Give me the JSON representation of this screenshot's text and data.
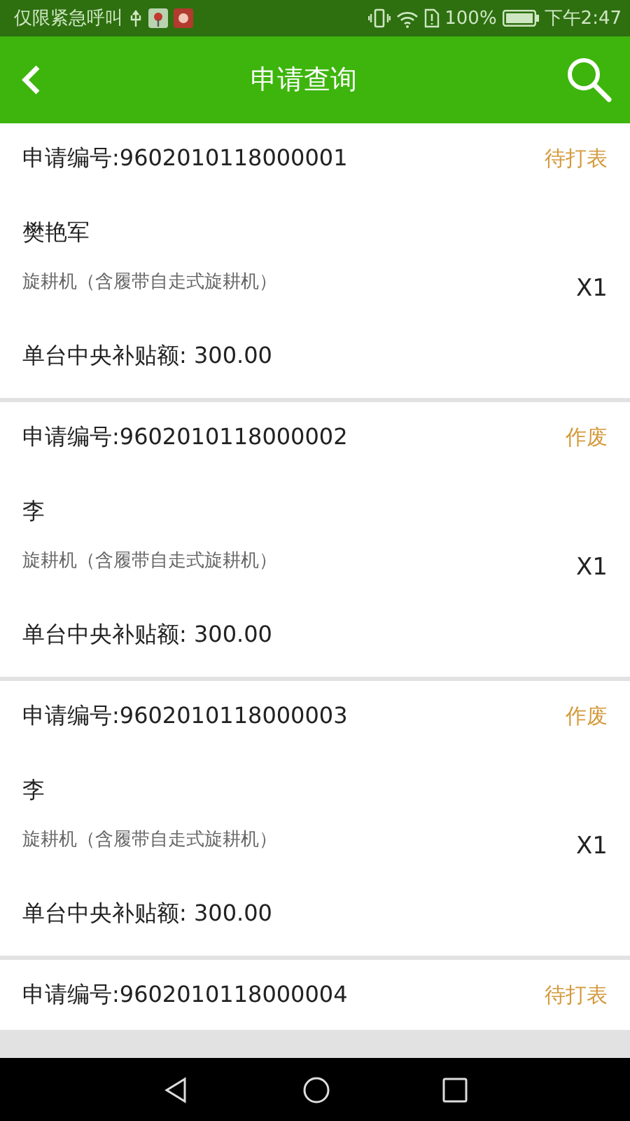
{
  "status_bar": {
    "carrier": "仅限紧急呼叫",
    "battery": "100%",
    "time": "下午2:47"
  },
  "header": {
    "title": "申请查询"
  },
  "records": [
    {
      "number": "申请编号:9602010118000001",
      "status": "待打表",
      "name": "樊艳军",
      "product": "旋耕机（含履带自走式旋耕机）",
      "quantity": "X1",
      "subsidy": "单台中央补贴额: 300.00"
    },
    {
      "number": "申请编号:9602010118000002",
      "status": "作废",
      "name": "李",
      "product": "旋耕机（含履带自走式旋耕机）",
      "quantity": "X1",
      "subsidy": "单台中央补贴额: 300.00"
    },
    {
      "number": "申请编号:9602010118000003",
      "status": "作废",
      "name": "李",
      "product": "旋耕机（含履带自走式旋耕机）",
      "quantity": "X1",
      "subsidy": "单台中央补贴额: 300.00"
    },
    {
      "number": "申请编号:9602010118000004",
      "status": "待打表"
    }
  ]
}
